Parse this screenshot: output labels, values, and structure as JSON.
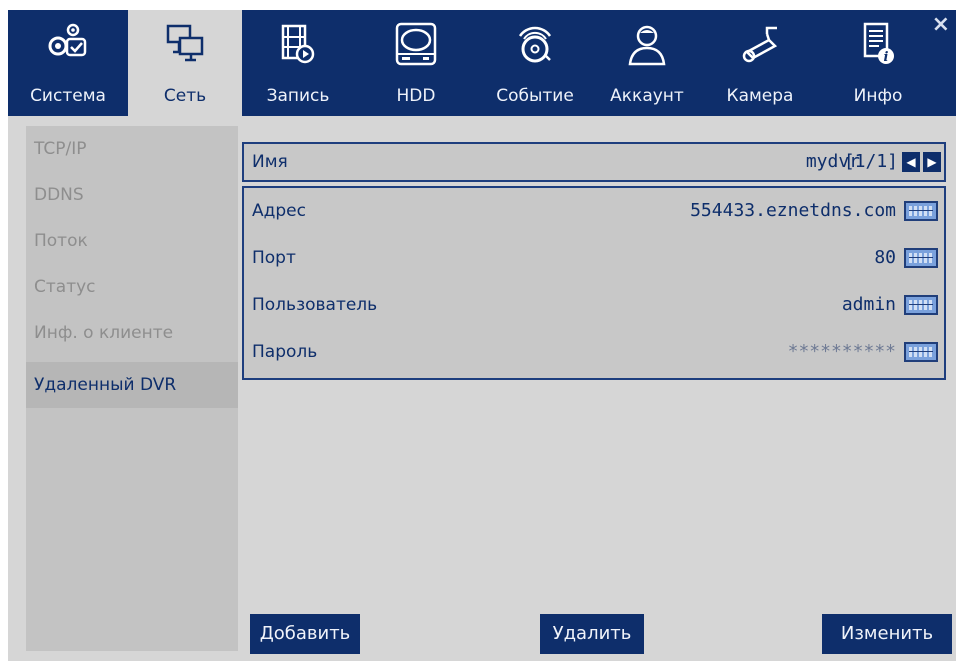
{
  "tabs": [
    {
      "label": "Система",
      "icon": "gears-check-icon"
    },
    {
      "label": "Сеть",
      "icon": "network-monitors-icon"
    },
    {
      "label": "Запись",
      "icon": "film-record-icon"
    },
    {
      "label": "HDD",
      "icon": "hard-drive-icon"
    },
    {
      "label": "Событие",
      "icon": "alarm-bell-icon"
    },
    {
      "label": "Аккаунт",
      "icon": "user-icon"
    },
    {
      "label": "Камера",
      "icon": "cctv-camera-icon"
    },
    {
      "label": "Инфо",
      "icon": "document-info-icon"
    }
  ],
  "active_tab": "Сеть",
  "sidebar": {
    "items": [
      {
        "label": "TCP/IP"
      },
      {
        "label": "DDNS"
      },
      {
        "label": "Поток"
      },
      {
        "label": "Статус"
      },
      {
        "label": "Инф. о клиенте"
      },
      {
        "label": "Удаленный DVR"
      }
    ],
    "active": "Удаленный DVR"
  },
  "form": {
    "name_label": "Имя",
    "name_value": "mydvr",
    "page_indicator": "[1/1]",
    "fields": [
      {
        "label": "Адрес",
        "value": "554433.eznetdns.com"
      },
      {
        "label": "Порт",
        "value": "80"
      },
      {
        "label": "Пользователь",
        "value": "admin"
      },
      {
        "label": "Пароль",
        "value": "**********"
      }
    ]
  },
  "buttons": {
    "add": "Добавить",
    "delete": "Удалить",
    "edit": "Изменить"
  },
  "colors": {
    "primary": "#0e2e6b",
    "panel_bg": "#d6d6d6",
    "sidebar_bg": "#c3c3c3",
    "keyboard_icon": "#7aa1dc"
  },
  "close_symbol": "×"
}
